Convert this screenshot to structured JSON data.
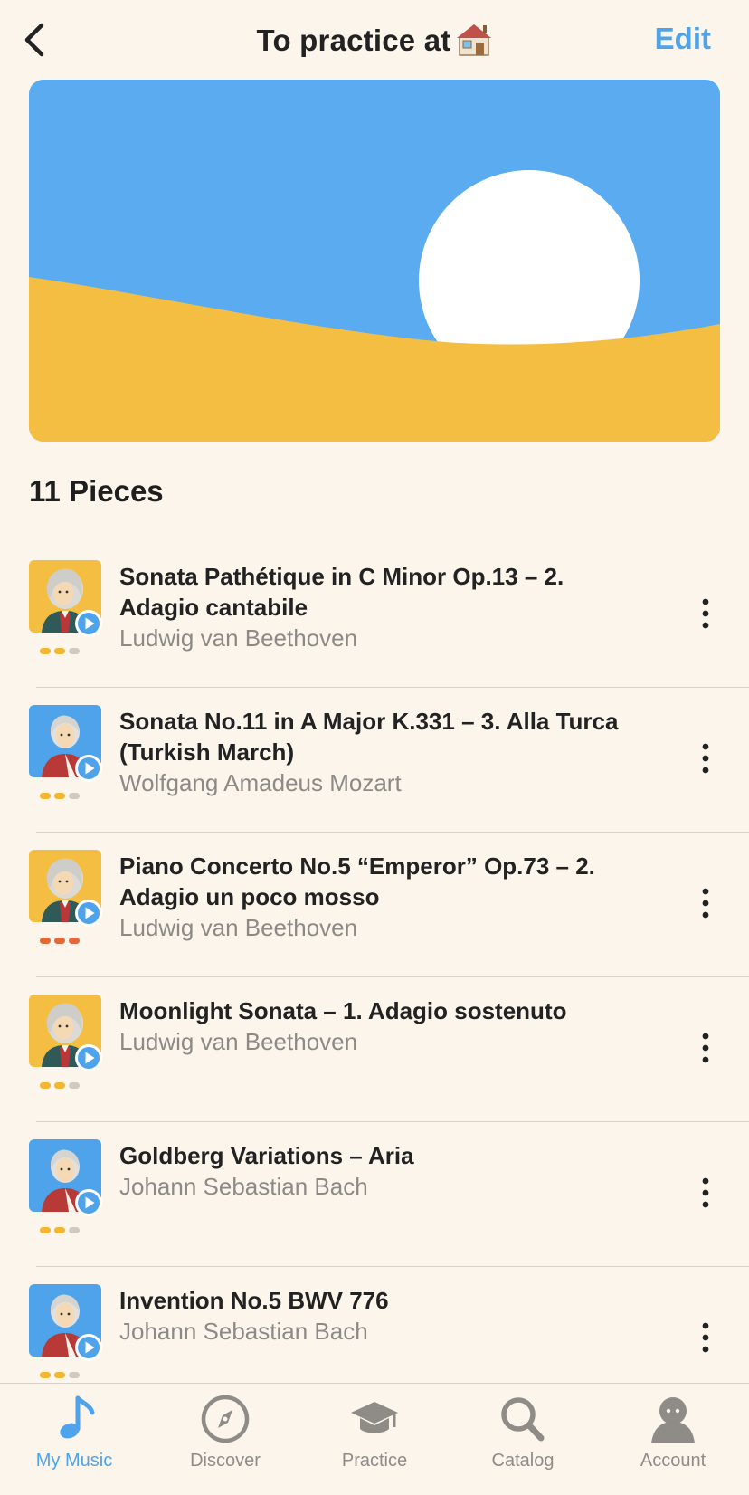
{
  "header": {
    "title": "To practice at",
    "title_emoji": "house-icon",
    "edit_label": "Edit"
  },
  "count_label": "11 Pieces",
  "pieces": [
    {
      "title": "Sonata Pathétique in C Minor Op.13 – 2. Adagio cantabile",
      "composer": "Ludwig van Beethoven",
      "portrait": "beethoven",
      "difficulty": [
        "#f2b632",
        "#f2b632",
        "#cfcac4"
      ]
    },
    {
      "title": "Sonata No.11 in A Major K.331 – 3. Alla Turca (Turkish March)",
      "composer": "Wolfgang Amadeus Mozart",
      "portrait": "mozart",
      "difficulty": [
        "#f2b632",
        "#f2b632",
        "#cfcac4"
      ]
    },
    {
      "title": "Piano Concerto No.5 “Emperor” Op.73 – 2. Adagio un poco mosso",
      "composer": "Ludwig van Beethoven",
      "portrait": "beethoven",
      "difficulty": [
        "#e0683a",
        "#e0683a",
        "#e0683a"
      ]
    },
    {
      "title": "Moonlight Sonata – 1. Adagio sostenuto",
      "composer": "Ludwig van Beethoven",
      "portrait": "beethoven",
      "difficulty": [
        "#f2b632",
        "#f2b632",
        "#cfcac4"
      ]
    },
    {
      "title": "Goldberg Variations – Aria",
      "composer": "Johann Sebastian Bach",
      "portrait": "bach",
      "difficulty": [
        "#f2b632",
        "#f2b632",
        "#cfcac4"
      ]
    },
    {
      "title": "Invention No.5 BWV 776",
      "composer": "Johann Sebastian Bach",
      "portrait": "bach",
      "difficulty": [
        "#f2b632",
        "#f2b632",
        "#cfcac4"
      ]
    }
  ],
  "tabs": [
    {
      "label": "My Music",
      "icon": "music-note-icon",
      "active": true
    },
    {
      "label": "Discover",
      "icon": "compass-icon",
      "active": false
    },
    {
      "label": "Practice",
      "icon": "graduation-cap-icon",
      "active": false
    },
    {
      "label": "Catalog",
      "icon": "search-icon",
      "active": false
    },
    {
      "label": "Account",
      "icon": "user-icon",
      "active": false
    }
  ],
  "colors": {
    "accent": "#4fa3ea",
    "background": "#fbf5ec",
    "banner_sky": "#5aabf0",
    "banner_sand": "#f4be43",
    "beethoven_bg": "#f4be43",
    "mozart_bach_bg": "#4fa3ea"
  }
}
